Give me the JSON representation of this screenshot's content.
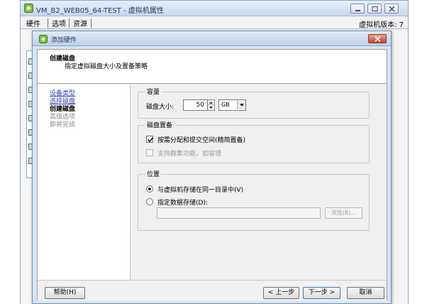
{
  "parent_window": {
    "title": "VM_B2_WEB05_64-TEST - 虚拟机属性",
    "tabs": [
      "硬件",
      "选项",
      "资源"
    ],
    "version_label": "虚拟机版本: 7"
  },
  "dialog": {
    "title": "添加硬件",
    "header_title": "创建磁盘",
    "header_subtitle": "指定虚拟磁盘大小及置备策略",
    "steps": [
      {
        "label": "设备类型",
        "state": "done"
      },
      {
        "label": "选择磁盘",
        "state": "done"
      },
      {
        "label": "创建磁盘",
        "state": "current"
      },
      {
        "label": "高级选项",
        "state": "todo"
      },
      {
        "label": "即将完成",
        "state": "todo"
      }
    ],
    "capacity": {
      "group_title": "容量",
      "label": "磁盘大小:",
      "value": "50",
      "unit": "GB"
    },
    "provisioning": {
      "group_title": "磁盘置备",
      "thick_label": "按需分配和提交空间(精简置备)",
      "thick_checked": true,
      "cluster_label": "支持群集功能，如容错",
      "cluster_checked": false
    },
    "location": {
      "group_title": "位置",
      "same_label": "与虚拟机存储在同一目录中(V)",
      "same_selected": true,
      "specify_label": "指定数据存储(D):",
      "datastore_value": "",
      "browse_label": "浏览(B)..."
    },
    "buttons": {
      "help": "帮助(H)",
      "back": "< 上一步",
      "next": "下一步 >",
      "cancel": "取消"
    }
  }
}
